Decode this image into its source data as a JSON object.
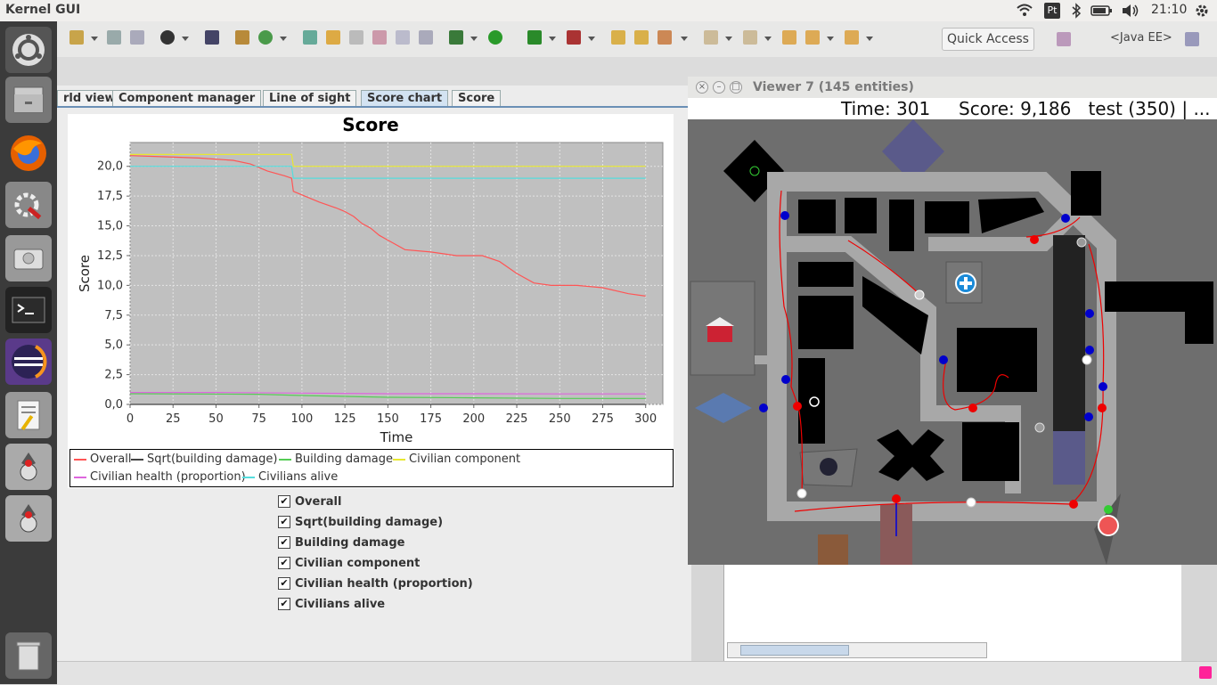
{
  "top_panel": {
    "app_title": "Kernel GUI",
    "clock": "21:10",
    "keyboard": "Pt"
  },
  "eclipse": {
    "quick_access": "Quick Access",
    "perspective": "<Java EE>"
  },
  "kernel": {
    "tabs": [
      "rld view",
      "Component manager",
      "Line of sight",
      "Score chart",
      "Score"
    ],
    "active_tab": "Score chart"
  },
  "chart_data": {
    "type": "line",
    "title": "Score",
    "xlabel": "Time",
    "ylabel": "Score",
    "xlim": [
      0,
      310
    ],
    "ylim": [
      0,
      22
    ],
    "xticks": [
      "0",
      "25",
      "50",
      "75",
      "100",
      "125",
      "150",
      "175",
      "200",
      "225",
      "250",
      "275",
      "300"
    ],
    "yticks": [
      "0,0",
      "2,5",
      "5,0",
      "7,5",
      "10,0",
      "12,5",
      "15,0",
      "17,5",
      "20,0"
    ],
    "grid": true,
    "legend_position": "bottom",
    "series": [
      {
        "name": "Overall",
        "color": "#ff5555",
        "x": [
          0,
          20,
          40,
          60,
          70,
          80,
          90,
          94,
          95,
          100,
          110,
          120,
          125,
          130,
          135,
          140,
          145,
          150,
          160,
          175,
          190,
          205,
          215,
          225,
          235,
          245,
          260,
          275,
          290,
          300
        ],
        "y": [
          20.9,
          20.8,
          20.7,
          20.5,
          20.2,
          19.6,
          19.2,
          19.0,
          17.9,
          17.6,
          17.0,
          16.5,
          16.2,
          15.8,
          15.2,
          14.8,
          14.2,
          13.8,
          13.0,
          12.8,
          12.5,
          12.5,
          12.0,
          11.0,
          10.2,
          10.0,
          10.0,
          9.8,
          9.3,
          9.1
        ]
      },
      {
        "name": "Sqrt(building damage)",
        "color": "#444444",
        "x": [
          0,
          300
        ],
        "y": [
          0.0,
          0.0
        ]
      },
      {
        "name": "Building damage",
        "color": "#55cc55",
        "x": [
          0,
          75,
          100,
          150,
          200,
          250,
          300
        ],
        "y": [
          0.9,
          0.85,
          0.75,
          0.6,
          0.55,
          0.5,
          0.5
        ]
      },
      {
        "name": "Civilian component",
        "color": "#e8e830",
        "x": [
          0,
          94,
          95,
          300
        ],
        "y": [
          21.0,
          21.0,
          20.0,
          20.0
        ]
      },
      {
        "name": "Civilian health (proportion)",
        "color": "#dd66dd",
        "x": [
          0,
          50,
          100,
          150,
          200,
          250,
          300
        ],
        "y": [
          1.0,
          1.0,
          0.95,
          0.9,
          0.9,
          0.88,
          0.88
        ]
      },
      {
        "name": "Civilians alive",
        "color": "#55dddd",
        "x": [
          0,
          94,
          95,
          300
        ],
        "y": [
          20.0,
          20.0,
          19.0,
          19.0
        ]
      }
    ]
  },
  "legend": {
    "items": [
      "Overall",
      "Sqrt(building damage)",
      "Building damage",
      "Civilian component",
      "Civilian health (proportion)",
      "Civilians alive"
    ]
  },
  "checkboxes": [
    "Overall",
    "Sqrt(building damage)",
    "Building damage",
    "Civilian component",
    "Civilian health (proportion)",
    "Civilians alive"
  ],
  "viewer": {
    "title": "Viewer 7 (145 entities)",
    "status": "Time: 301     Score: 9,186   test (350) | ..."
  },
  "colors": {
    "launcher": "#3b3b3b",
    "panel": "#f0efed",
    "map_background": "#6e6e6e",
    "road": "#9a9a9a",
    "building": "#000000",
    "agent_red": "#ee0000",
    "agent_blue": "#0000cc"
  }
}
